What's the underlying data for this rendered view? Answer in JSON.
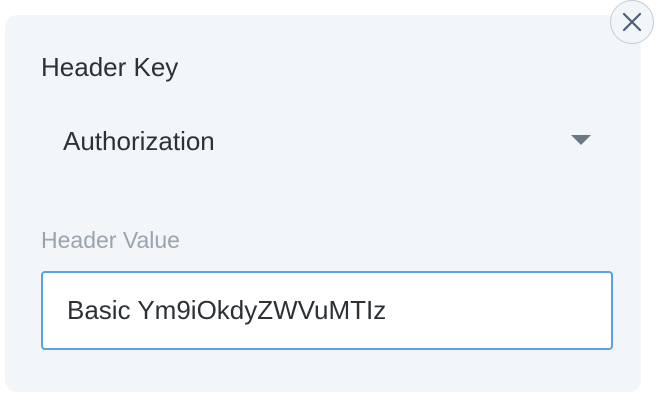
{
  "header_key": {
    "label": "Header Key",
    "selected": "Authorization"
  },
  "header_value": {
    "label": "Header Value",
    "value": "Basic Ym9iOkdyZWVuMTIz"
  },
  "icons": {
    "close": "close-icon",
    "dropdown": "caret-down-icon"
  },
  "colors": {
    "panel_background": "#f3f6f9",
    "input_border_focus": "#5aa2e5",
    "label_muted": "#9aa4ae",
    "text": "#2d3136"
  }
}
